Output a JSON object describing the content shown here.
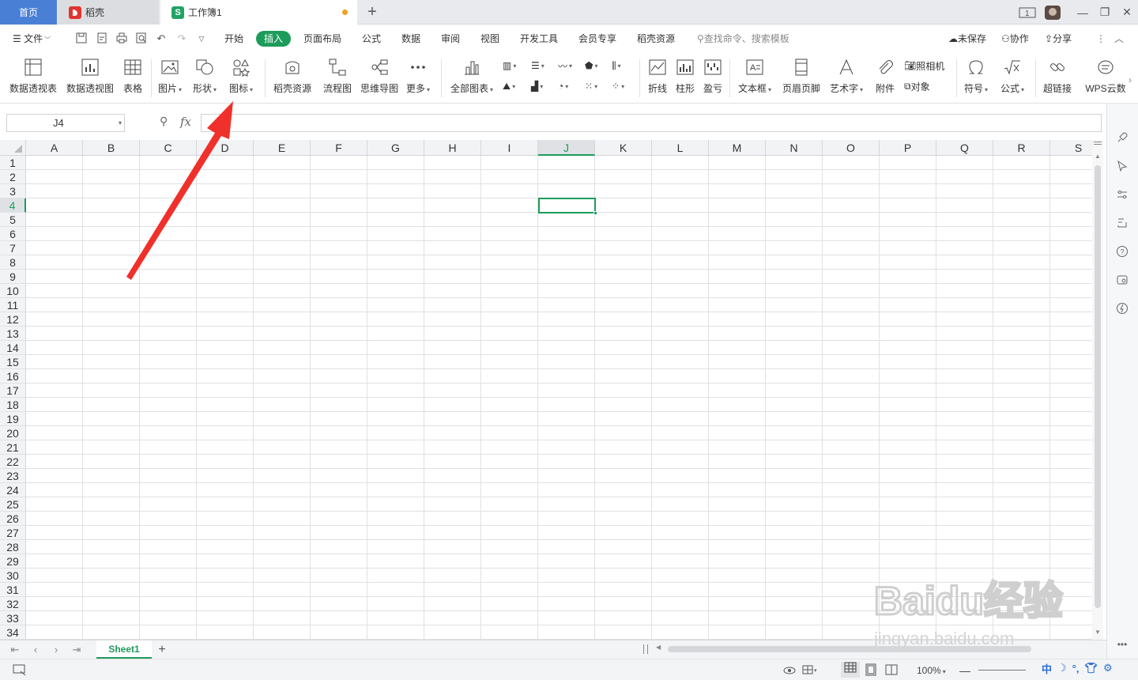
{
  "tabs": {
    "home": "首页",
    "daoke": "稻壳",
    "workbook": "工作簿1",
    "workbook_icon": "S"
  },
  "menu": {
    "file": "文件",
    "items": [
      "开始",
      "插入",
      "页面布局",
      "公式",
      "数据",
      "审阅",
      "视图",
      "开发工具",
      "会员专享",
      "稻壳资源"
    ],
    "active": "插入",
    "search_placeholder": "查找命令、搜索模板",
    "unsaved": "未保存",
    "collab": "协作",
    "share": "分享"
  },
  "ribbon": {
    "pivot_table": "数据透视表",
    "pivot_chart": "数据透视图",
    "table": "表格",
    "picture": "图片",
    "shape": "形状",
    "icon": "图标",
    "daoke_res": "稻壳资源",
    "flowchart": "流程图",
    "mindmap": "思维导图",
    "more": "更多",
    "all_charts": "全部图表",
    "line": "折线",
    "column": "柱形",
    "winloss": "盈亏",
    "textbox": "文本框",
    "header_footer": "页眉页脚",
    "wordart": "艺术字",
    "attachment": "附件",
    "camera": "照相机",
    "object": "对象",
    "symbol": "符号",
    "formula": "公式",
    "hyperlink": "超链接",
    "wps_cloud": "WPS云数"
  },
  "formula_bar": {
    "cell_ref": "J4",
    "fx": "fx",
    "value": ""
  },
  "grid": {
    "columns": [
      "A",
      "B",
      "C",
      "D",
      "E",
      "F",
      "G",
      "H",
      "I",
      "J",
      "K",
      "L",
      "M",
      "N",
      "O",
      "P",
      "Q",
      "R",
      "S"
    ],
    "rows": [
      "1",
      "2",
      "3",
      "4",
      "5",
      "6",
      "7",
      "8",
      "9",
      "10",
      "11",
      "12",
      "13",
      "14",
      "15",
      "16",
      "17",
      "18",
      "19",
      "20",
      "21",
      "22",
      "23",
      "24",
      "25",
      "26",
      "27",
      "28",
      "29",
      "30",
      "31",
      "32",
      "33",
      "34"
    ],
    "selected_column": "J",
    "selected_row": "4"
  },
  "sheets": {
    "active": "Sheet1",
    "add": "+"
  },
  "status": {
    "zoom": "100%",
    "ime": "中"
  },
  "watermark": {
    "brand": "Baidu经验",
    "url": "jingyan.baidu.com"
  },
  "colors": {
    "accent": "#1e9c5b",
    "home_tab": "#4a7fd6",
    "arrow": "#f0302a"
  }
}
